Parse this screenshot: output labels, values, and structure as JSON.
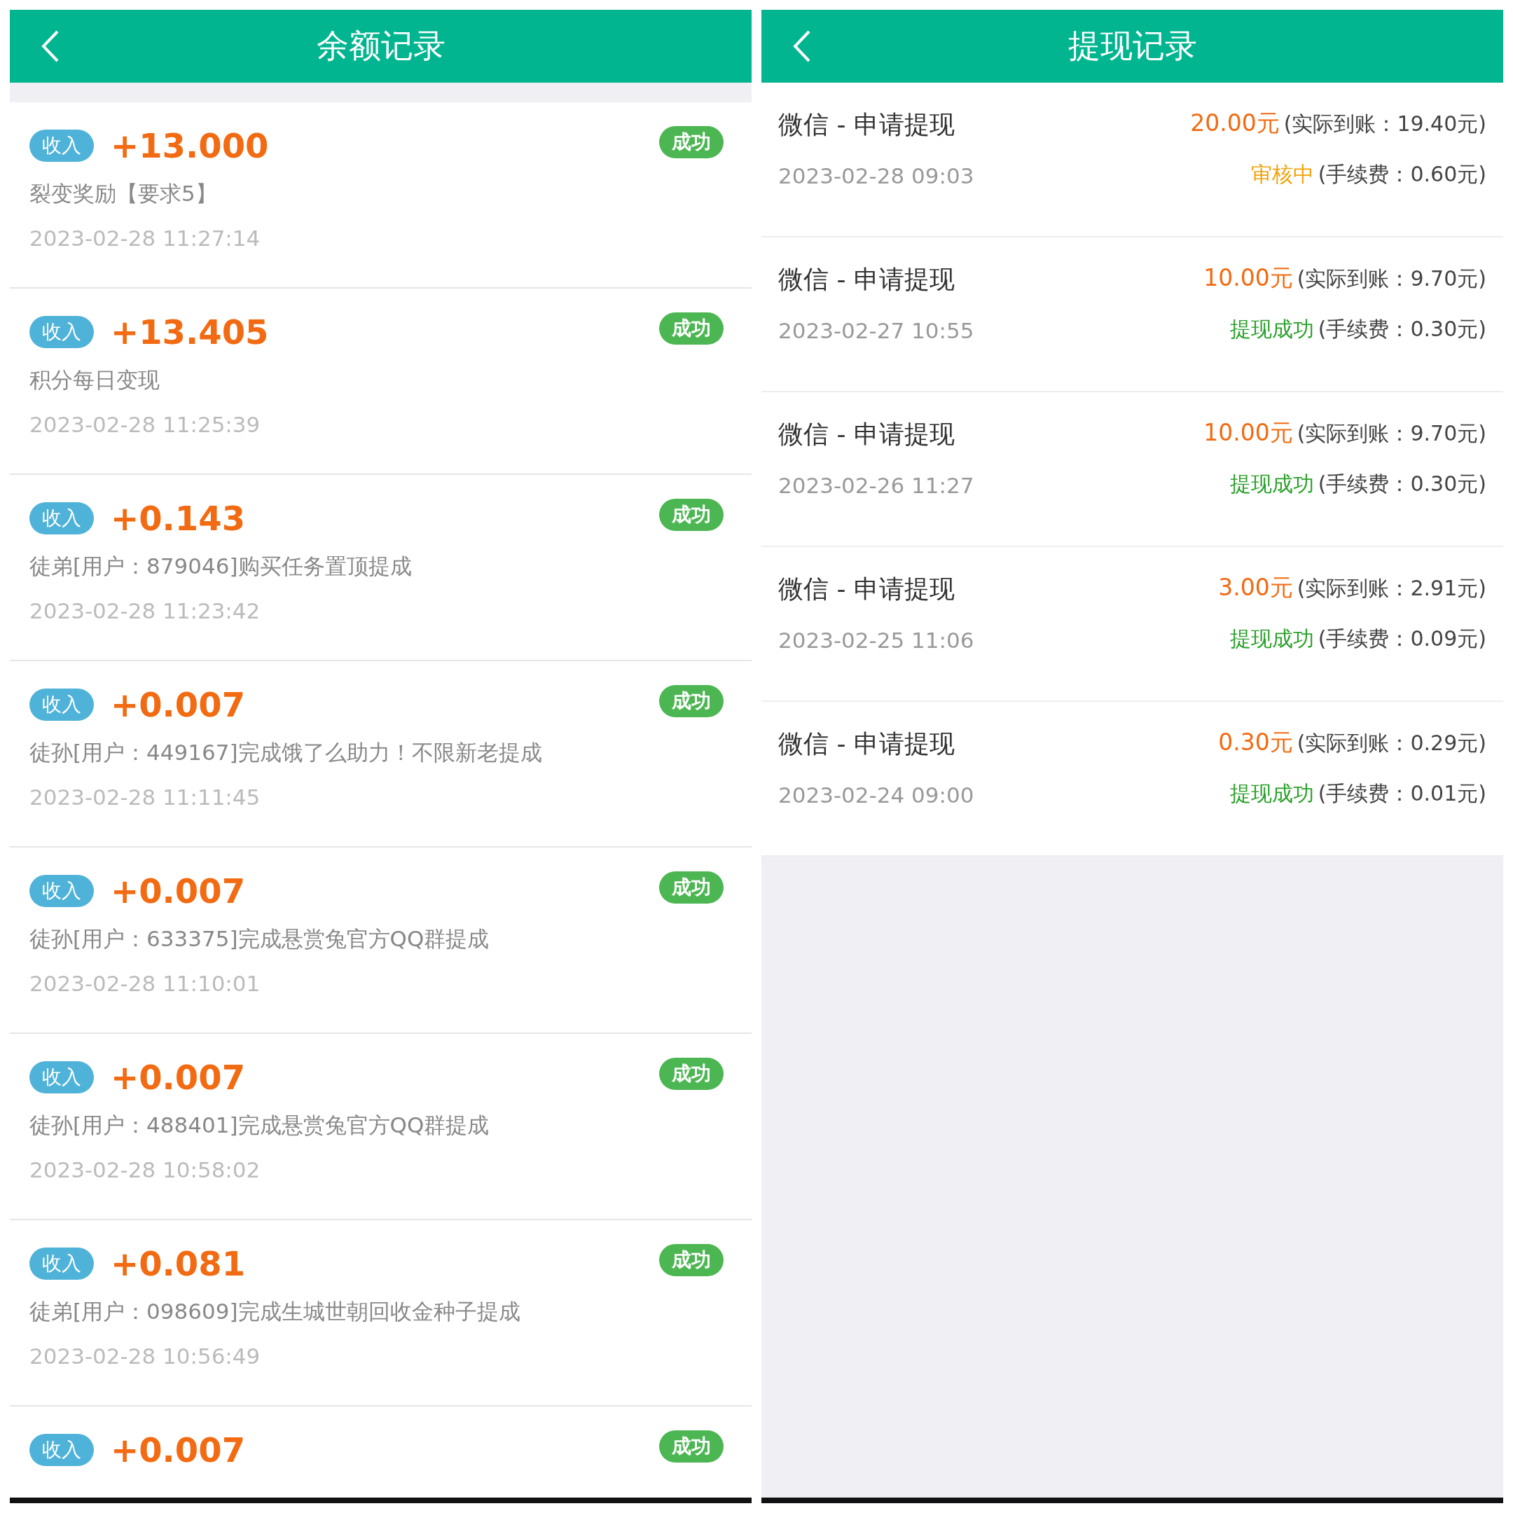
{
  "balance_screen": {
    "title": "余额记录",
    "records": [
      {
        "tag": "收入",
        "amount": "+13.000",
        "status": "成功",
        "description": "裂变奖励【要求5】",
        "time": "2023-02-28 11:27:14"
      },
      {
        "tag": "收入",
        "amount": "+13.405",
        "status": "成功",
        "description": "积分每日变现",
        "time": "2023-02-28 11:25:39"
      },
      {
        "tag": "收入",
        "amount": "+0.143",
        "status": "成功",
        "description": "徒弟[用户：879046]购买任务置顶提成",
        "time": "2023-02-28 11:23:42"
      },
      {
        "tag": "收入",
        "amount": "+0.007",
        "status": "成功",
        "description": "徒孙[用户：449167]完成饿了么助力！不限新老提成",
        "time": "2023-02-28 11:11:45"
      },
      {
        "tag": "收入",
        "amount": "+0.007",
        "status": "成功",
        "description": "徒孙[用户：633375]完成悬赏兔官方QQ群提成",
        "time": "2023-02-28 11:10:01"
      },
      {
        "tag": "收入",
        "amount": "+0.007",
        "status": "成功",
        "description": "徒孙[用户：488401]完成悬赏兔官方QQ群提成",
        "time": "2023-02-28 10:58:02"
      },
      {
        "tag": "收入",
        "amount": "+0.081",
        "status": "成功",
        "description": "徒弟[用户：098609]完成生城世朝回收金种子提成",
        "time": "2023-02-28 10:56:49"
      },
      {
        "tag": "收入",
        "amount": "+0.007",
        "status": "成功"
      }
    ]
  },
  "withdraw_screen": {
    "title": "提现记录",
    "records": [
      {
        "title": "微信 - 申请提现",
        "amount": "20.00元",
        "received": "(实际到账：19.40元)",
        "time": "2023-02-28 09:03",
        "status": "审核中",
        "kind": "pending",
        "fee": "(手续费：0.60元)"
      },
      {
        "title": "微信 - 申请提现",
        "amount": "10.00元",
        "received": "(实际到账：9.70元)",
        "time": "2023-02-27 10:55",
        "status": "提现成功",
        "kind": "success",
        "fee": "(手续费：0.30元)"
      },
      {
        "title": "微信 - 申请提现",
        "amount": "10.00元",
        "received": "(实际到账：9.70元)",
        "time": "2023-02-26 11:27",
        "status": "提现成功",
        "kind": "success",
        "fee": "(手续费：0.30元)"
      },
      {
        "title": "微信 - 申请提现",
        "amount": "3.00元",
        "received": "(实际到账：2.91元)",
        "time": "2023-02-25 11:06",
        "status": "提现成功",
        "kind": "success",
        "fee": "(手续费：0.09元)"
      },
      {
        "title": "微信 - 申请提现",
        "amount": "0.30元",
        "received": "(实际到账：0.29元)",
        "time": "2023-02-24 09:00",
        "status": "提现成功",
        "kind": "success",
        "fee": "(手续费：0.01元)"
      }
    ]
  }
}
